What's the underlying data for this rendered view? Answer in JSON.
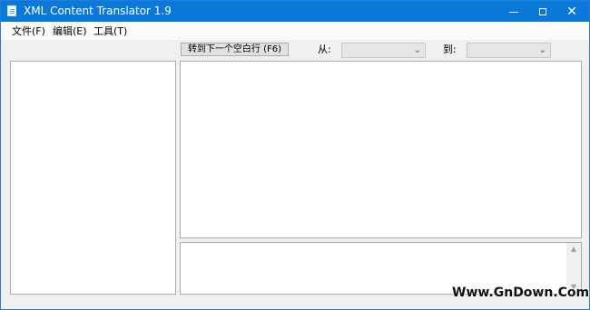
{
  "window": {
    "title": "XML Content Translator 1.9",
    "icon": "document-icon"
  },
  "menu": {
    "items": [
      "文件(F)",
      "编辑(E)",
      "工具(T)"
    ]
  },
  "toolbar": {
    "next_blank_label": "转到下一个空白行 (F6)",
    "from_label": "从:",
    "to_label": "到:",
    "from_value": "",
    "to_value": ""
  },
  "panels": {
    "left_text": "",
    "main_text": "",
    "bottom_text": ""
  },
  "watermark": "Www.GnDown.Com",
  "colors": {
    "titlebar": "#0a79d9",
    "background": "#f0f0f0",
    "panel": "#ffffff"
  }
}
